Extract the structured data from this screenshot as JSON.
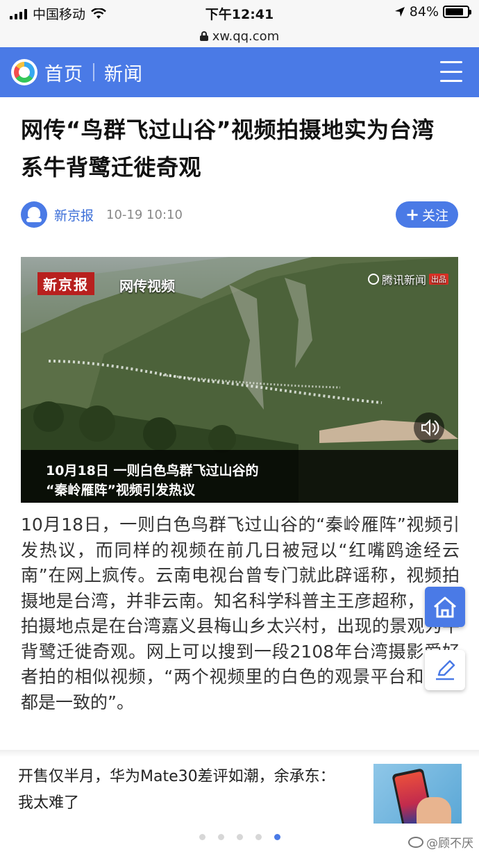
{
  "status_bar": {
    "carrier": "中国移动",
    "time": "下午12:41",
    "battery": "84%",
    "battery_level": 0.84
  },
  "browser": {
    "url": "xw.qq.com"
  },
  "app_header": {
    "home_label": "首页",
    "section_label": "新闻"
  },
  "article": {
    "title": "网传“鸟群飞过山谷”视频拍摄地实为台湾 系牛背鹭迁徙奇观",
    "source": "新京报",
    "time": "10-19 10:10",
    "follow_label": "关注",
    "video": {
      "brand_tag": "新京报",
      "label": "网传视频",
      "watermark": "腾讯新闻",
      "watermark_badge": "出品",
      "subtitle_line1": "10月18日  一则白色鸟群飞过山谷的",
      "subtitle_line2": "“秦岭雁阵”视频引发热议"
    },
    "body": "10月18日，一则白色鸟群飞过山谷的“秦岭雁阵”视频引发热议，而同样的视频在前几日被冠以“红嘴鸥途经云南”在网上疯传。云南电视台曾专门就此辟谣称，视频拍摄地是台湾，并非云南。知名科学科普主王彦超称，视频拍摄地点是在台湾嘉义县梅山乡太兴村，出现的景观为牛背鹭迁徙奇观。网上可以搜到一段2108年台湾摄影爱好者拍的相似视频，“两个视频里的白色的观景平台和山谷都是一致的”。"
  },
  "recommended": {
    "title": "开售仅半月，华为Mate30差评如潮，余承东：我太难了",
    "active_dot": 5,
    "dot_count": 5
  },
  "watermark": {
    "text": "@顾不厌"
  },
  "colors": {
    "brand_blue": "#4a7ae6",
    "source_blue": "#3d6fd8",
    "tag_red": "#b8201e"
  }
}
